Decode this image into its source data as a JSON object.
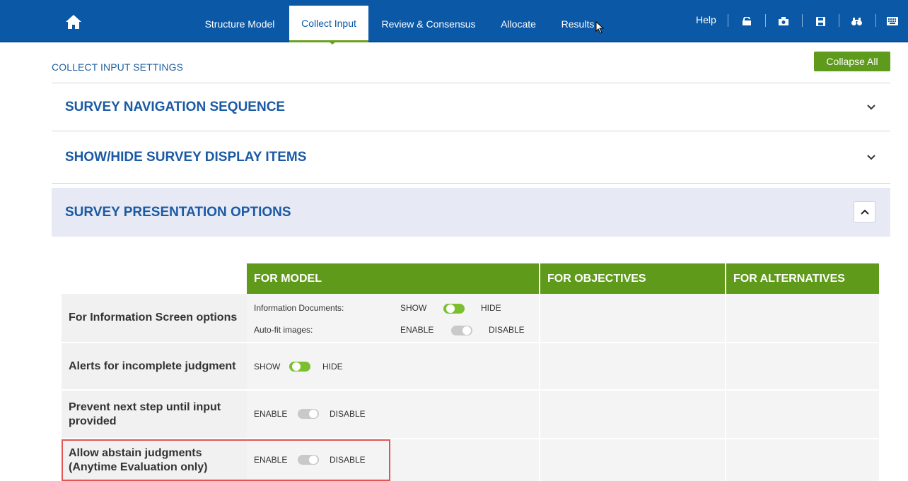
{
  "topnav": {
    "tabs": [
      "Structure Model",
      "Collect Input",
      "Review & Consensus",
      "Allocate",
      "Results"
    ],
    "active_tab": "Collect Input",
    "help_label": "Help",
    "tool_icons": [
      "unlock-icon",
      "camera-icon",
      "save-icon",
      "binoculars-icon",
      "keyboard-icon"
    ]
  },
  "page": {
    "title": "COLLECT INPUT SETTINGS",
    "collapse_all": "Collapse All"
  },
  "sections": [
    {
      "title": "SURVEY NAVIGATION SEQUENCE",
      "expanded": false
    },
    {
      "title": "SHOW/HIDE SURVEY DISPLAY ITEMS",
      "expanded": false
    },
    {
      "title": "SURVEY PRESENTATION OPTIONS",
      "expanded": true
    }
  ],
  "table": {
    "headers": [
      "FOR MODEL",
      "FOR OBJECTIVES",
      "FOR ALTERNATIVES"
    ],
    "rows": [
      {
        "label": "For Information Screen options",
        "options": [
          {
            "name": "Information Documents:",
            "left": "SHOW",
            "right": "HIDE",
            "state": "on"
          },
          {
            "name": "Auto-fit images:",
            "left": "ENABLE",
            "right": "DISABLE",
            "state": "off"
          }
        ]
      },
      {
        "label": "Alerts for incomplete judgment",
        "left": "SHOW",
        "right": "HIDE",
        "state": "on"
      },
      {
        "label": "Prevent next step until input provided",
        "left": "ENABLE",
        "right": "DISABLE",
        "state": "off"
      },
      {
        "label": "Allow abstain judgments (Anytime Evaluation only)",
        "left": "ENABLE",
        "right": "DISABLE",
        "state": "off"
      }
    ]
  },
  "colors": {
    "nav_blue": "#0b58a6",
    "header_green": "#5f9a1a",
    "toggle_on": "#7bbf2e",
    "highlight_red": "#e05555"
  }
}
